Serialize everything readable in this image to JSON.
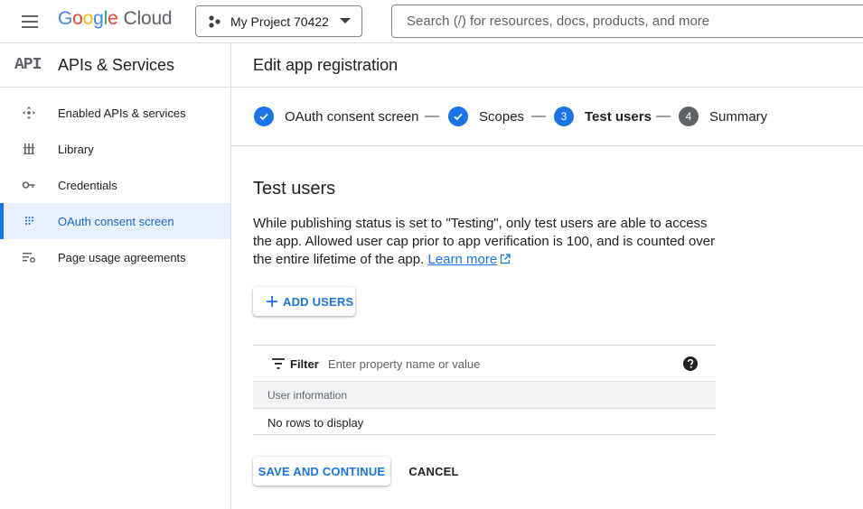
{
  "topbar": {
    "menu_icon": "hamburger-menu-icon",
    "logo": {
      "g": "G",
      "o1": "o",
      "o2": "o",
      "g2": "g",
      "l": "l",
      "e": "e",
      "product": "Cloud"
    },
    "project": {
      "icon": "project-hierarchy-icon",
      "label": "My Project 70422"
    },
    "search": {
      "placeholder": "Search (/) for resources, docs, products, and more"
    }
  },
  "sidebar": {
    "badge": "API",
    "title": "APIs & Services",
    "items": [
      {
        "label": "Enabled APIs & services",
        "icon": "enabled-apis-icon",
        "active": false
      },
      {
        "label": "Library",
        "icon": "library-icon",
        "active": false
      },
      {
        "label": "Credentials",
        "icon": "key-icon",
        "active": false
      },
      {
        "label": "OAuth consent screen",
        "icon": "oauth-grid-icon",
        "active": true
      },
      {
        "label": "Page usage agreements",
        "icon": "settings-list-icon",
        "active": false
      }
    ]
  },
  "main": {
    "title": "Edit app registration",
    "steps": [
      {
        "label": "OAuth consent screen",
        "state": "done"
      },
      {
        "label": "Scopes",
        "state": "done"
      },
      {
        "label": "Test users",
        "state": "current",
        "number": "3"
      },
      {
        "label": "Summary",
        "state": "todo",
        "number": "4"
      }
    ],
    "section_title": "Test users",
    "description": "While publishing status is set to \"Testing\", only test users are able to access the app. Allowed user cap prior to app verification is 100, and is counted over the entire lifetime of the app.",
    "learn_more": "Learn more",
    "add_users_label": "ADD USERS",
    "filter": {
      "label": "Filter",
      "placeholder": "Enter property name or value"
    },
    "table": {
      "column_header": "User information",
      "empty_text": "No rows to display"
    },
    "save_label": "SAVE AND CONTINUE",
    "cancel_label": "CANCEL"
  },
  "colors": {
    "accent": "#1a73e8",
    "active_bg": "#e8f0fe",
    "divider": "#dadce0"
  }
}
